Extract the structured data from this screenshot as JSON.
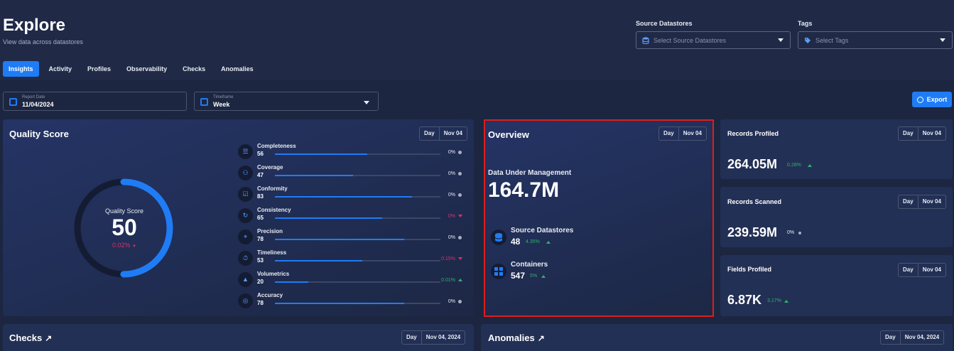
{
  "header": {
    "title": "Explore",
    "subtitle": "View data across datastores",
    "source_datastores_label": "Source Datastores",
    "source_datastores_placeholder": "Select Source Datastores",
    "tags_label": "Tags",
    "tags_placeholder": "Select Tags"
  },
  "tabs": [
    {
      "label": "Insights",
      "active": true
    },
    {
      "label": "Activity"
    },
    {
      "label": "Profiles"
    },
    {
      "label": "Observability"
    },
    {
      "label": "Checks"
    },
    {
      "label": "Anomalies"
    }
  ],
  "filters": {
    "report_date_label": "Report Date",
    "report_date_value": "11/04/2024",
    "timeframe_label": "Timeframe",
    "timeframe_value": "Week",
    "export_label": "Export"
  },
  "quality": {
    "title": "Quality Score",
    "period": "Day",
    "date": "Nov 04",
    "score_label": "Quality Score",
    "score": "50",
    "change": "0.02%",
    "score_fraction": 0.5,
    "metrics": [
      {
        "name": "Completeness",
        "value": "56",
        "pct": "0%",
        "trend": "flat",
        "level": 0.56,
        "icon": "list-icon"
      },
      {
        "name": "Coverage",
        "value": "47",
        "pct": "0%",
        "trend": "flat",
        "level": 0.47,
        "icon": "group-icon"
      },
      {
        "name": "Conformity",
        "value": "83",
        "pct": "0%",
        "trend": "flat",
        "level": 0.83,
        "icon": "checkbox-icon"
      },
      {
        "name": "Consistency",
        "value": "65",
        "pct": "0%",
        "trend": "down",
        "level": 0.65,
        "icon": "sync-icon"
      },
      {
        "name": "Precision",
        "value": "78",
        "pct": "0%",
        "trend": "flat",
        "level": 0.78,
        "icon": "target-icon"
      },
      {
        "name": "Timeliness",
        "value": "53",
        "pct": "0.15%",
        "trend": "down",
        "level": 0.53,
        "icon": "stopwatch-icon"
      },
      {
        "name": "Volumetrics",
        "value": "20",
        "pct": "0.01%",
        "trend": "up",
        "level": 0.2,
        "icon": "shapes-icon"
      },
      {
        "name": "Accuracy",
        "value": "78",
        "pct": "0%",
        "trend": "flat",
        "level": 0.78,
        "icon": "bullseye-icon"
      }
    ]
  },
  "overview": {
    "title": "Overview",
    "period": "Day",
    "date": "Nov 04",
    "dum_label": "Data Under Management",
    "dum_value": "164.7M",
    "source_label": "Source Datastores",
    "source_value": "48",
    "source_change": "4.35%",
    "containers_label": "Containers",
    "containers_value": "547",
    "containers_change": "5%"
  },
  "records_profiled": {
    "title": "Records Profiled",
    "period": "Day",
    "date": "Nov 04",
    "value": "264.05M",
    "change": "0.28%"
  },
  "records_scanned": {
    "title": "Records Scanned",
    "period": "Day",
    "date": "Nov 04",
    "value": "239.59M",
    "change": "0%"
  },
  "fields_profiled": {
    "title": "Fields Profiled",
    "period": "Day",
    "date": "Nov 04",
    "value": "6.87K",
    "change": "3.17%"
  },
  "checks": {
    "title": "Checks",
    "period": "Day",
    "date": "Nov 04, 2024"
  },
  "anomalies": {
    "title": "Anomalies",
    "period": "Day",
    "date": "Nov 04, 2024"
  },
  "colors": {
    "accent": "#1f7cf5",
    "negative": "#d8336b",
    "positive": "#2fb36a",
    "highlight": "#e01d1d"
  }
}
